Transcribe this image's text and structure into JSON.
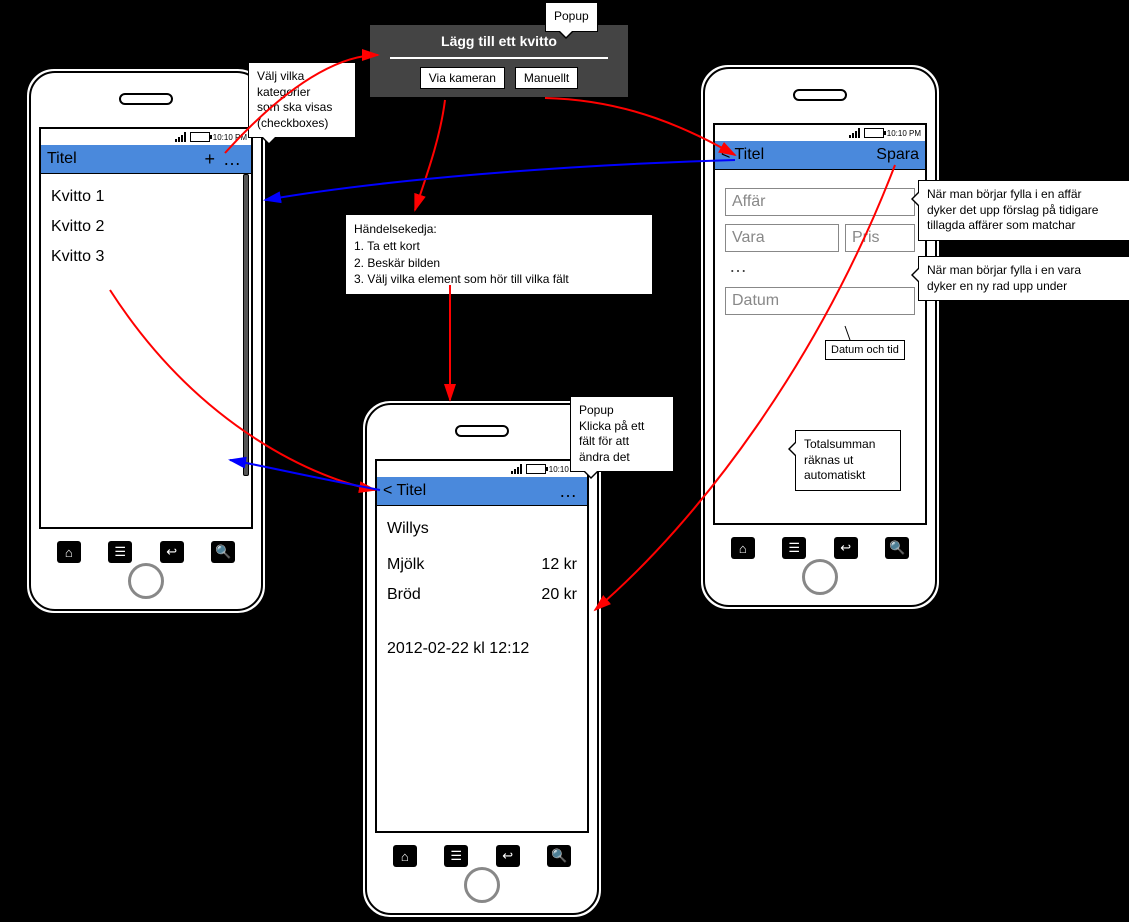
{
  "status_time": "10:10 PM",
  "phone1": {
    "title": "Titel",
    "plus": "+",
    "more": "…",
    "items": [
      "Kvitto 1",
      "Kvitto 2",
      "Kvitto 3"
    ]
  },
  "phone2": {
    "title": "< Titel",
    "more": "…",
    "store": "Willys",
    "items": [
      {
        "name": "Mjölk",
        "price": "12 kr"
      },
      {
        "name": "Bröd",
        "price": "20 kr"
      }
    ],
    "date": "2012-02-22 kl 12:12"
  },
  "phone3": {
    "title": "< Titel",
    "save": "Spara",
    "fields": {
      "store": "Affär",
      "item": "Vara",
      "price": "Pris",
      "more": "…",
      "date": "Datum"
    },
    "date_hint": "Datum och tid"
  },
  "popup": {
    "title": "Lägg till ett kvitto",
    "btn1": "Via kameran",
    "btn2": "Manuellt",
    "label": "Popup"
  },
  "callouts": {
    "checkboxes": "Välj vilka\nkategorier\nsom ska visas\n(checkboxes)",
    "chain_title": "Händelsekedja:",
    "chain": [
      "1. Ta ett kort",
      "2. Beskär bilden",
      "3. Välj vilka element som hör till vilka fält"
    ],
    "edit_popup": "Popup\nKlicka på ett\nfält för att\nändra det",
    "store_hint": "När man börjar fylla i en affär\ndyker det upp förslag på tidigare\ntillagda affärer som matchar",
    "item_hint": "När man börjar fylla i en vara\ndyker en ny rad upp under",
    "total_hint": "Totalsumman\nräknas ut\nautomatiskt"
  }
}
